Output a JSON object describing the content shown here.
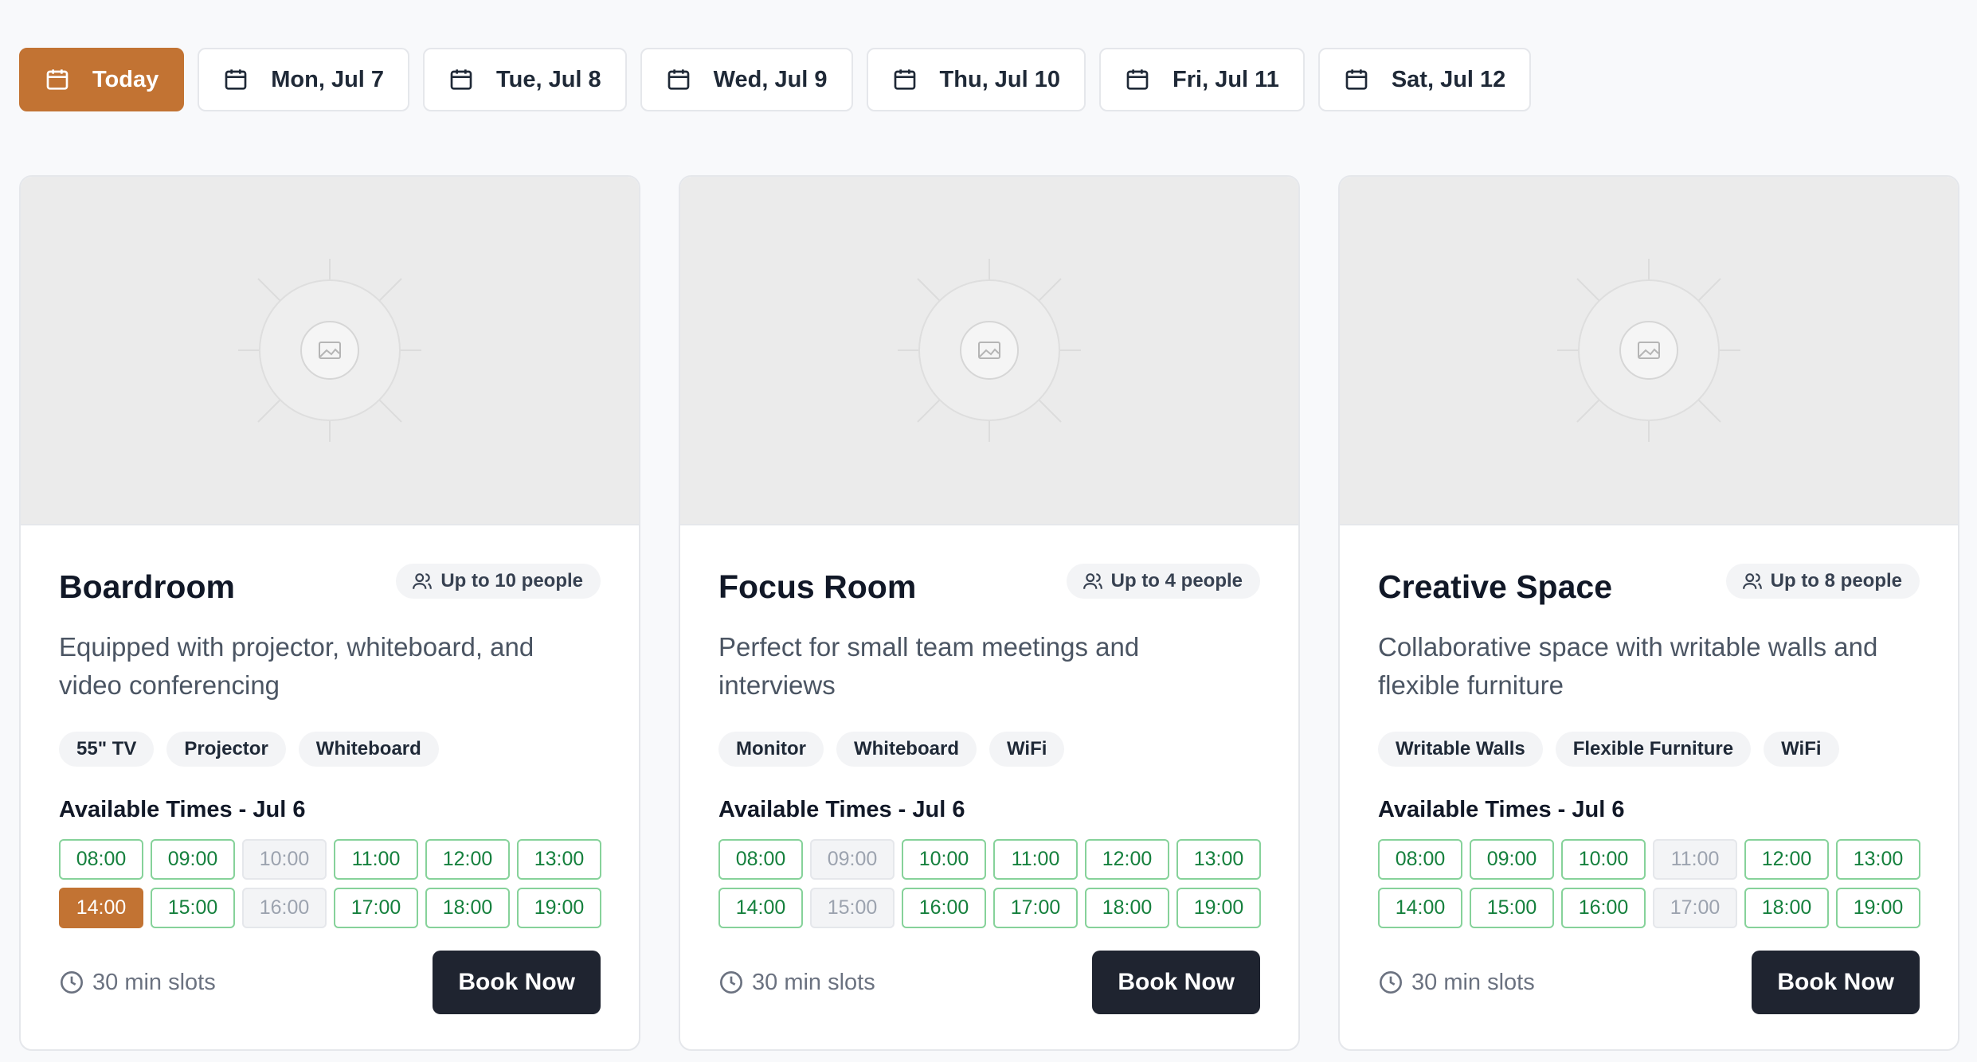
{
  "dates": [
    {
      "label": "Today",
      "active": true
    },
    {
      "label": "Mon, Jul 7",
      "active": false
    },
    {
      "label": "Tue, Jul 8",
      "active": false
    },
    {
      "label": "Wed, Jul 9",
      "active": false
    },
    {
      "label": "Thu, Jul 10",
      "active": false
    },
    {
      "label": "Fri, Jul 11",
      "active": false
    },
    {
      "label": "Sat, Jul 12",
      "active": false
    }
  ],
  "colors": {
    "accent": "#c27333",
    "available": "#15803d",
    "dark_button": "#1f2430"
  },
  "rooms": [
    {
      "name": "Boardroom",
      "capacity": "Up to 10 people",
      "description": "Equipped with projector, whiteboard, and video conferencing",
      "amenities": [
        "55\" TV",
        "Projector",
        "Whiteboard"
      ],
      "availability_label": "Available Times - Jul 6",
      "slots": [
        {
          "time": "08:00",
          "state": "available"
        },
        {
          "time": "09:00",
          "state": "available"
        },
        {
          "time": "10:00",
          "state": "unavailable"
        },
        {
          "time": "11:00",
          "state": "available"
        },
        {
          "time": "12:00",
          "state": "available"
        },
        {
          "time": "13:00",
          "state": "available"
        },
        {
          "time": "14:00",
          "state": "selected"
        },
        {
          "time": "15:00",
          "state": "available"
        },
        {
          "time": "16:00",
          "state": "unavailable"
        },
        {
          "time": "17:00",
          "state": "available"
        },
        {
          "time": "18:00",
          "state": "available"
        },
        {
          "time": "19:00",
          "state": "available"
        }
      ],
      "slot_info": "30 min slots",
      "book_label": "Book Now"
    },
    {
      "name": "Focus Room",
      "capacity": "Up to 4 people",
      "description": "Perfect for small team meetings and interviews",
      "amenities": [
        "Monitor",
        "Whiteboard",
        "WiFi"
      ],
      "availability_label": "Available Times - Jul 6",
      "slots": [
        {
          "time": "08:00",
          "state": "available"
        },
        {
          "time": "09:00",
          "state": "unavailable"
        },
        {
          "time": "10:00",
          "state": "available"
        },
        {
          "time": "11:00",
          "state": "available"
        },
        {
          "time": "12:00",
          "state": "available"
        },
        {
          "time": "13:00",
          "state": "available"
        },
        {
          "time": "14:00",
          "state": "available"
        },
        {
          "time": "15:00",
          "state": "unavailable"
        },
        {
          "time": "16:00",
          "state": "available"
        },
        {
          "time": "17:00",
          "state": "available"
        },
        {
          "time": "18:00",
          "state": "available"
        },
        {
          "time": "19:00",
          "state": "available"
        }
      ],
      "slot_info": "30 min slots",
      "book_label": "Book Now"
    },
    {
      "name": "Creative Space",
      "capacity": "Up to 8 people",
      "description": "Collaborative space with writable walls and flexible furniture",
      "amenities": [
        "Writable Walls",
        "Flexible Furniture",
        "WiFi"
      ],
      "availability_label": "Available Times - Jul 6",
      "slots": [
        {
          "time": "08:00",
          "state": "available"
        },
        {
          "time": "09:00",
          "state": "available"
        },
        {
          "time": "10:00",
          "state": "available"
        },
        {
          "time": "11:00",
          "state": "unavailable"
        },
        {
          "time": "12:00",
          "state": "available"
        },
        {
          "time": "13:00",
          "state": "available"
        },
        {
          "time": "14:00",
          "state": "available"
        },
        {
          "time": "15:00",
          "state": "available"
        },
        {
          "time": "16:00",
          "state": "available"
        },
        {
          "time": "17:00",
          "state": "unavailable"
        },
        {
          "time": "18:00",
          "state": "available"
        },
        {
          "time": "19:00",
          "state": "available"
        }
      ],
      "slot_info": "30 min slots",
      "book_label": "Book Now"
    }
  ]
}
